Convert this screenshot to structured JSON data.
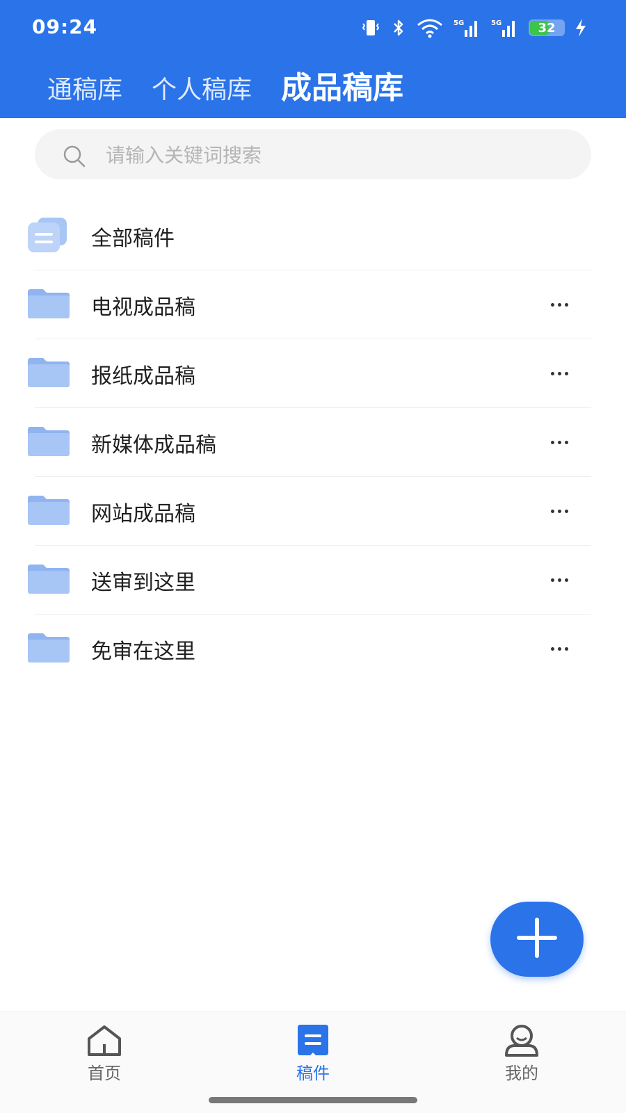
{
  "status_bar": {
    "time": "09:24",
    "battery": "32",
    "battery_level_percent": 32,
    "network_labels": [
      "5G",
      "5G"
    ]
  },
  "header": {
    "tabs": [
      {
        "label": "通稿库",
        "active": false
      },
      {
        "label": "个人稿库",
        "active": false
      },
      {
        "label": "成品稿库",
        "active": true
      }
    ]
  },
  "search": {
    "placeholder": "请输入关键词搜索",
    "value": ""
  },
  "folders": [
    {
      "label": "全部稿件",
      "icon": "stack-icon",
      "has_more": false
    },
    {
      "label": "电视成品稿",
      "icon": "folder-icon",
      "has_more": true
    },
    {
      "label": "报纸成品稿",
      "icon": "folder-icon",
      "has_more": true
    },
    {
      "label": "新媒体成品稿",
      "icon": "folder-icon",
      "has_more": true
    },
    {
      "label": "网站成品稿",
      "icon": "folder-icon",
      "has_more": true
    },
    {
      "label": "送审到这里",
      "icon": "folder-icon",
      "has_more": true
    },
    {
      "label": "免审在这里",
      "icon": "folder-icon",
      "has_more": true
    }
  ],
  "fab": {
    "icon": "plus-icon"
  },
  "bottom_nav": [
    {
      "label": "首页",
      "icon": "home-icon",
      "active": false
    },
    {
      "label": "稿件",
      "icon": "document-icon",
      "active": true
    },
    {
      "label": "我的",
      "icon": "profile-icon",
      "active": false
    }
  ],
  "colors": {
    "primary": "#2a73e8",
    "folder": "#a7c5f5",
    "folder_tab": "#8fb4ef",
    "search_bg": "#f4f4f4",
    "battery": "#3bc54a"
  }
}
